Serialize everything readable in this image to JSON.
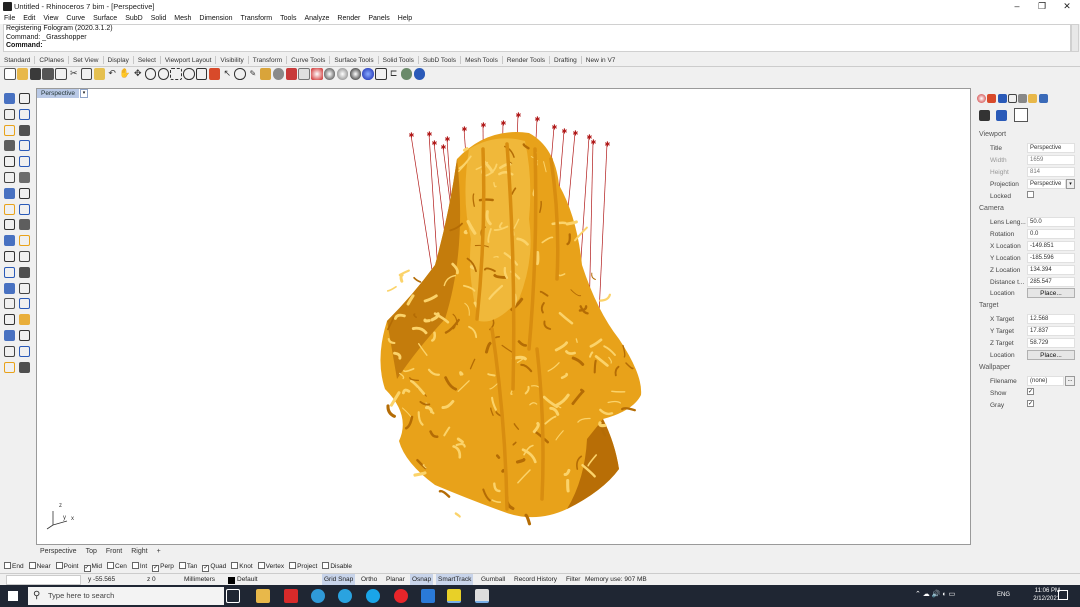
{
  "window": {
    "title": "Untitled - Rhinoceros 7 bim - [Perspective]",
    "controls": [
      "–",
      "❐",
      "✕"
    ]
  },
  "menu": [
    "File",
    "Edit",
    "View",
    "Curve",
    "Surface",
    "SubD",
    "Solid",
    "Mesh",
    "Dimension",
    "Transform",
    "Tools",
    "Analyze",
    "Render",
    "Panels",
    "Help"
  ],
  "command": {
    "lines": [
      "Registering Fologram (2020.3.1.2)",
      "Command: _Grasshopper"
    ],
    "prompt": "Command:"
  },
  "tabs": [
    "Standard",
    "CPlanes",
    "Set View",
    "Display",
    "Select",
    "Viewport Layout",
    "Visibility",
    "Transform",
    "Curve Tools",
    "Surface Tools",
    "Solid Tools",
    "SubD Tools",
    "Mesh Tools",
    "Render Tools",
    "Drafting",
    "New in V7"
  ],
  "viewport": {
    "label": "Perspective",
    "tabs": [
      "Perspective",
      "Top",
      "Front",
      "Right",
      "+"
    ],
    "axes": {
      "z": "z",
      "y": "y",
      "x": "x"
    }
  },
  "properties": {
    "viewport_header": "Viewport",
    "title_label": "Title",
    "title_value": "Perspective",
    "width_label": "Width",
    "width_value": "1659",
    "height_label": "Height",
    "height_value": "814",
    "projection_label": "Projection",
    "projection_value": "Perspective",
    "locked_label": "Locked",
    "camera_header": "Camera",
    "lens_label": "Lens Leng...",
    "lens_value": "50.0",
    "rotation_label": "Rotation",
    "rotation_value": "0.0",
    "xloc_label": "X Location",
    "xloc_value": "-149.851",
    "yloc_label": "Y Location",
    "yloc_value": "-185.596",
    "zloc_label": "Z Location",
    "zloc_value": "134.394",
    "dist_label": "Distance t...",
    "dist_value": "285.547",
    "cam_location_label": "Location",
    "place_button": "Place...",
    "target_header": "Target",
    "xt_label": "X Target",
    "xt_value": "12.568",
    "yt_label": "Y Target",
    "yt_value": "17.837",
    "zt_label": "Z Target",
    "zt_value": "58.729",
    "t_location_label": "Location",
    "wallpaper_header": "Wallpaper",
    "filename_label": "Filename",
    "filename_value": "(none)",
    "filename_browse": "...",
    "show_label": "Show",
    "gray_label": "Gray"
  },
  "osnap": [
    {
      "label": "End",
      "checked": false
    },
    {
      "label": "Near",
      "checked": false
    },
    {
      "label": "Point",
      "checked": false
    },
    {
      "label": "Mid",
      "checked": true
    },
    {
      "label": "Cen",
      "checked": false
    },
    {
      "label": "Int",
      "checked": false
    },
    {
      "label": "Perp",
      "checked": true
    },
    {
      "label": "Tan",
      "checked": false
    },
    {
      "label": "Quad",
      "checked": true
    },
    {
      "label": "Knot",
      "checked": false
    },
    {
      "label": "Vertex",
      "checked": false
    },
    {
      "label": "Project",
      "checked": false
    },
    {
      "label": "Disable",
      "checked": false
    }
  ],
  "status": {
    "y": "y -55.565",
    "z": "z 0",
    "units": "Millimeters",
    "layer": "Default",
    "grid_snap": "Grid Snap",
    "ortho": "Ortho",
    "planar": "Planar",
    "osnap": "Osnap",
    "smarttrack": "SmartTrack",
    "gumball": "Gumball",
    "record": "Record History",
    "filter": "Filter",
    "memory": "Memory use: 907 MB"
  },
  "taskbar": {
    "search_placeholder": "Type here to search",
    "lang": "ENG",
    "time": "11:06 PM",
    "date": "2/12/2021"
  },
  "colors": {
    "model": "#e8a21a",
    "model_dark": "#b46c05",
    "leader": "#b01818",
    "viewport_label": "#b9c9e6",
    "taskbar": "#1f2633"
  }
}
